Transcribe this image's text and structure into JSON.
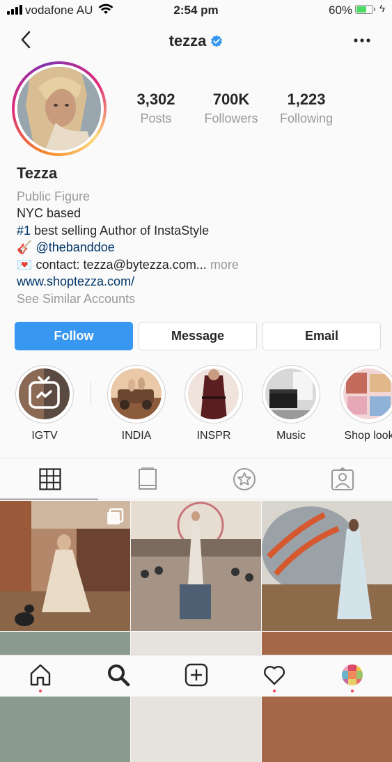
{
  "status_bar": {
    "carrier": "vodafone AU",
    "time": "2:54 pm",
    "battery_percent": "60%",
    "battery_level": 0.6
  },
  "header": {
    "username": "tezza",
    "verified": true,
    "back_icon": "chevron-left-icon",
    "more_icon": "ellipsis-icon"
  },
  "stats": [
    {
      "value": "3,302",
      "label": "Posts"
    },
    {
      "value": "700K",
      "label": "Followers"
    },
    {
      "value": "1,223",
      "label": "Following"
    }
  ],
  "bio": {
    "name": "Tezza",
    "category": "Public Figure",
    "line1": "NYC based",
    "hashtag": "#1",
    "line2_rest": " best selling Author of InstaStyle",
    "guitar_emoji": "🎸",
    "mention": "@thebanddoe",
    "letter_emoji": "💌",
    "contact": "contact: tezza@bytezza.com...",
    "more": "more",
    "website": "www.shoptezza.com/",
    "similar": "See Similar Accounts"
  },
  "buttons": {
    "follow": "Follow",
    "message": "Message",
    "email": "Email"
  },
  "highlights": [
    {
      "label": "IGTV"
    },
    {
      "label": "INDIA"
    },
    {
      "label": "INSPR"
    },
    {
      "label": "Music"
    },
    {
      "label": "Shop look"
    }
  ],
  "tabs": [
    "grid-icon",
    "igtv-tab-icon",
    "star-icon",
    "tagged-person-icon"
  ],
  "bottom_nav": [
    "home-icon",
    "search-icon",
    "add-post-icon",
    "heart-icon",
    "profile-icon"
  ],
  "colors": {
    "accent": "#3897f0",
    "link": "#003569",
    "secondary_text": "#999999",
    "notification_dot": "#ed4956"
  }
}
